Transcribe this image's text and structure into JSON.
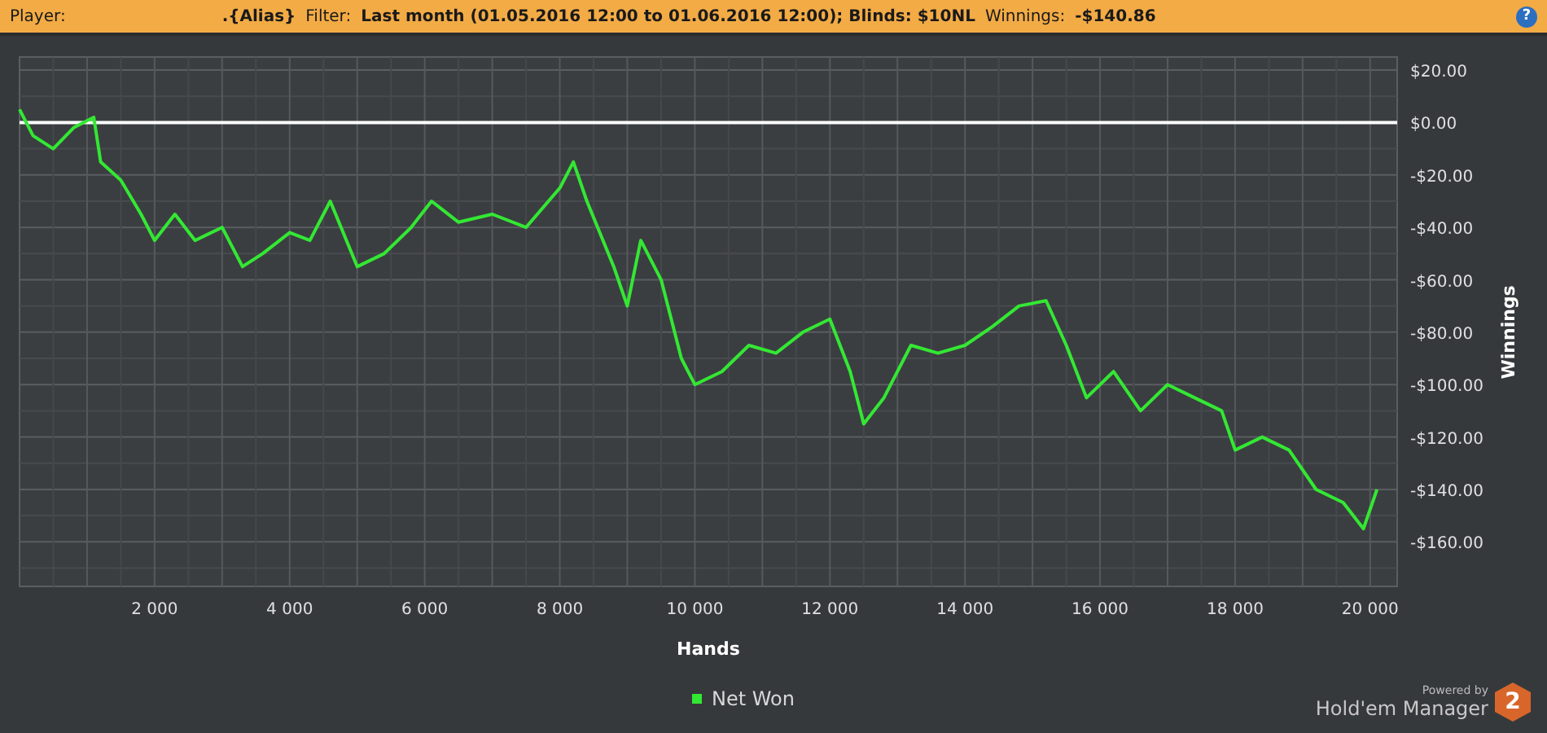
{
  "header": {
    "segments": [
      {
        "kind": "label",
        "text": "Player:"
      },
      {
        "kind": "value",
        "text": ".{Alias}"
      },
      {
        "kind": "label",
        "text": "Filter:"
      },
      {
        "kind": "value",
        "text": "Last month (01.05.2016 12:00 to 01.06.2016 12:00); Blinds: $10NL"
      },
      {
        "kind": "label",
        "text": "Winnings:"
      },
      {
        "kind": "value",
        "text": "-$140.86"
      }
    ],
    "help": "?"
  },
  "chart_data": {
    "type": "line",
    "grid": true,
    "xlabel": "Hands",
    "ylabel": "Winnings",
    "xlim": [
      0,
      20400
    ],
    "ylim": [
      -177,
      25
    ],
    "xticks": [
      {
        "value": 2000,
        "label": "2 000"
      },
      {
        "value": 4000,
        "label": "4 000"
      },
      {
        "value": 6000,
        "label": "6 000"
      },
      {
        "value": 8000,
        "label": "8 000"
      },
      {
        "value": 10000,
        "label": "10 000"
      },
      {
        "value": 12000,
        "label": "12 000"
      },
      {
        "value": 14000,
        "label": "14 000"
      },
      {
        "value": 16000,
        "label": "16 000"
      },
      {
        "value": 18000,
        "label": "18 000"
      },
      {
        "value": 20000,
        "label": "20 000"
      }
    ],
    "yticks": [
      {
        "value": 20,
        "label": "$20.00"
      },
      {
        "value": 0,
        "label": "$0.00"
      },
      {
        "value": -20,
        "label": "-$20.00"
      },
      {
        "value": -40,
        "label": "-$40.00"
      },
      {
        "value": -60,
        "label": "-$60.00"
      },
      {
        "value": -80,
        "label": "-$80.00"
      },
      {
        "value": -100,
        "label": "-$100.00"
      },
      {
        "value": -120,
        "label": "-$120.00"
      },
      {
        "value": -140,
        "label": "-$140.00"
      },
      {
        "value": -160,
        "label": "-$160.00"
      }
    ],
    "x": [
      0,
      200,
      500,
      800,
      1100,
      1200,
      1500,
      1800,
      2000,
      2300,
      2600,
      3000,
      3300,
      3600,
      4000,
      4300,
      4600,
      5000,
      5400,
      5800,
      6100,
      6500,
      7000,
      7500,
      8000,
      8200,
      8400,
      8800,
      9000,
      9200,
      9500,
      9800,
      10000,
      10400,
      10800,
      11200,
      11600,
      12000,
      12300,
      12500,
      12800,
      13200,
      13600,
      14000,
      14400,
      14800,
      15200,
      15500,
      15800,
      16200,
      16600,
      17000,
      17400,
      17800,
      18000,
      18400,
      18800,
      19200,
      19600,
      19900,
      20100
    ],
    "series": [
      {
        "name": "Net Won",
        "color": "#33e833",
        "values": [
          5,
          -5,
          -10,
          -2,
          2,
          -15,
          -22,
          -35,
          -45,
          -35,
          -45,
          -40,
          -55,
          -50,
          -42,
          -45,
          -30,
          -55,
          -50,
          -40,
          -30,
          -38,
          -35,
          -40,
          -25,
          -15,
          -30,
          -55,
          -70,
          -45,
          -60,
          -90,
          -100,
          -95,
          -85,
          -88,
          -80,
          -75,
          -95,
          -115,
          -105,
          -85,
          -88,
          -85,
          -78,
          -70,
          -68,
          -85,
          -105,
          -95,
          -110,
          -100,
          -105,
          -110,
          -125,
          -120,
          -125,
          -140,
          -145,
          -155,
          -140
        ]
      }
    ]
  },
  "brand": {
    "powered": "Powered by",
    "name": "Hold'em Manager",
    "badge": "2"
  }
}
